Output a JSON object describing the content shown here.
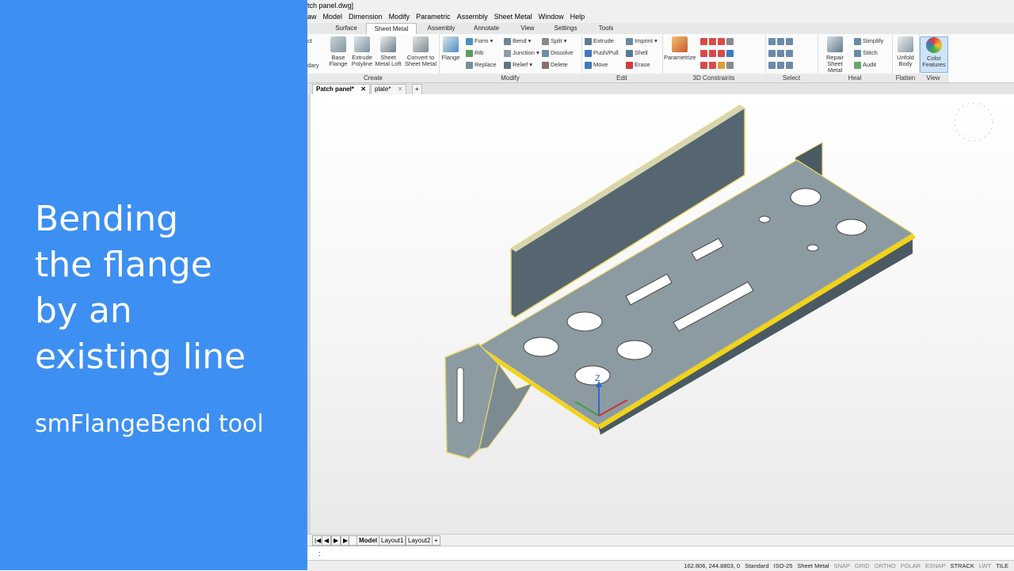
{
  "overlay": {
    "title_lines": [
      "Bending",
      "the flange",
      "by an",
      "existing line"
    ],
    "subtitle": "smFlangeBend tool",
    "background_color": "#3d8ff2"
  },
  "window": {
    "title": "tch panel.dwg]"
  },
  "menu": [
    "aw",
    "Model",
    "Dimension",
    "Modify",
    "Parametric",
    "Assembly",
    "Sheet Metal",
    "Window",
    "Help"
  ],
  "ribbon_tabs": [
    "Surface",
    "Sheet Metal",
    "Assembly",
    "Annotate",
    "View",
    "Settings",
    "Tools"
  ],
  "ribbon_active_tab": "Sheet Metal",
  "ribbon": {
    "create": {
      "label": "Create",
      "partial_items": [
        "ct",
        "dary"
      ],
      "buttons": [
        {
          "label": "Base Flange",
          "icon": "base-flange-icon"
        },
        {
          "label": "Extrude Polyline",
          "icon": "extrude-polyline-icon"
        },
        {
          "label": "Sheet Metal Loft",
          "icon": "sheet-metal-loft-icon"
        },
        {
          "label": "Convert to Sheet Metal",
          "icon": "convert-icon"
        }
      ]
    },
    "modify": {
      "label": "Modify",
      "flange": "Flange",
      "items": [
        "Form",
        "Rib",
        "Replace",
        "Bend",
        "Junction",
        "Relief",
        "Split",
        "Dissolve",
        "Delete"
      ]
    },
    "edit": {
      "label": "Edit",
      "items": [
        "Extrude",
        "Push/Pull",
        "Move",
        "Imprint",
        "Shell",
        "Erase"
      ]
    },
    "constraints": {
      "label": "3D Constraints",
      "parametrize": "Parametrize"
    },
    "select": {
      "label": "Select"
    },
    "heal": {
      "label": "Heal",
      "repair": "Repair Sheet Metal",
      "items": [
        "Simplify",
        "Stitch",
        "Audit"
      ]
    },
    "flatten": {
      "label": "Flatten",
      "unfold": "Unfold Body"
    },
    "view": {
      "label": "View",
      "color_features": "Color Features"
    }
  },
  "document_tabs": [
    {
      "label": "Patch panel*",
      "active": true
    },
    {
      "label": "plate*",
      "active": false
    }
  ],
  "layout_tabs": [
    "Model",
    "Layout1",
    "Layout2"
  ],
  "command_prompt": ":",
  "status": {
    "coords": "162.806, 244.8803, 0",
    "items": [
      "Standard",
      "ISO-25",
      "Sheet Metal",
      "SNAP",
      "GRID",
      "ORTHO",
      "POLAR",
      "ESNAP",
      "STRACK",
      "LWT",
      "TILE"
    ]
  },
  "axis_label": "Z",
  "colors": {
    "panel_face": "#8c9ba2",
    "panel_side": "#4b5a62",
    "highlight": "#f2d31b",
    "edge": "#e8d66a"
  }
}
